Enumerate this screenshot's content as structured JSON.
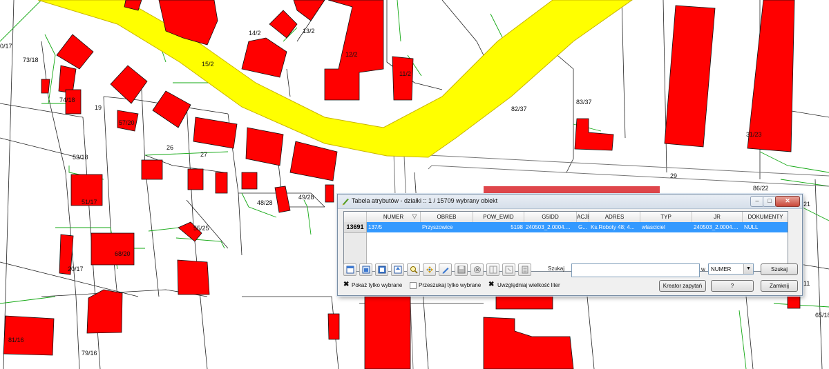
{
  "map": {
    "parcel_labels": [
      "0/17",
      "73/18",
      "14/2",
      "13/2",
      "12/2",
      "15/2",
      "11/2",
      "74/18",
      "19",
      "57/20",
      "82/37",
      "83/37",
      "26",
      "27",
      "53/18",
      "31/23",
      "29",
      "86/22",
      "51/17",
      "48/28",
      "49/28",
      "55/25",
      "68/20",
      "21",
      "20/17",
      "81/16",
      "79/16",
      "65/18",
      "11"
    ],
    "colors": {
      "building": "#ff0000",
      "road": "#ffff00",
      "parcel_line": "#00aa00",
      "road_edge": "#777777"
    }
  },
  "window": {
    "title": "Tabela atrybutów - działki :: 1 / 15709 wybrany obiekt",
    "controls": {
      "minimize": "–",
      "maximize": "□",
      "close": "✕"
    },
    "table": {
      "columns": [
        "NUMER",
        "OBREB",
        "POW_EWID",
        "G5IDD",
        "ACJE",
        "ADRES",
        "TYP",
        "JR",
        "DOKUMENTY"
      ],
      "rows": [
        {
          "id": "13691",
          "cells": [
            "137/5",
            "Przyszowice",
            "5198",
            "240503_2.0004....",
            "G...",
            "Ks.Roboty 48; 4...",
            "wlasciciel",
            "240503_2.0004....",
            "NULL"
          ]
        }
      ]
    },
    "toolbar": {
      "icons": [
        "deselect-icon",
        "select-all-icon",
        "invert-selection-icon",
        "move-selection-top-icon",
        "zoom-to-selection-icon",
        "pan-to-selection-icon",
        "edit-pencil-icon",
        "save-icon",
        "delete-icon",
        "new-column-icon",
        "delete-column-icon",
        "calculator-icon"
      ],
      "search_label": "Szukaj",
      "search_value": "",
      "in_label": "w",
      "field_select": "NUMER",
      "search_button": "Szukaj"
    },
    "options": {
      "show_selected": "Pokaż tylko wybrane",
      "search_selected": "Przeszukaj tylko wybrane",
      "case_sensitive": "Uwzględniaj wielkość liter",
      "show_selected_checked": true,
      "search_selected_checked": false,
      "case_sensitive_checked": true
    },
    "buttons": {
      "query_builder": "Kreator zapytań",
      "help": "?",
      "close": "Zamknij"
    }
  }
}
